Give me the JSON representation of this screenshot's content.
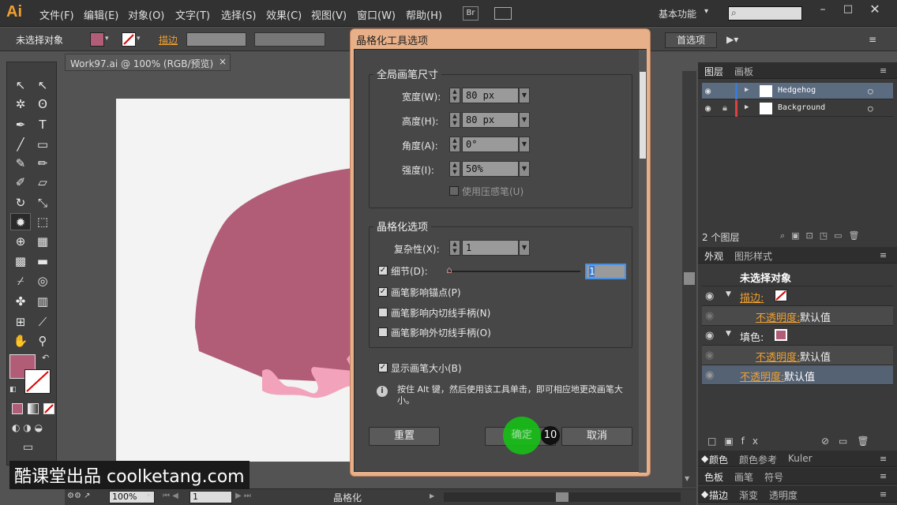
{
  "app": {
    "logo": "Ai"
  },
  "menus": [
    "文件(F)",
    "编辑(E)",
    "对象(O)",
    "文字(T)",
    "选择(S)",
    "效果(C)",
    "视图(V)",
    "窗口(W)",
    "帮助(H)"
  ],
  "menubar": {
    "br_label": "Br",
    "workspace": "基本功能",
    "workspace_arrow": "▾"
  },
  "control_bar": {
    "selection": "未选择对象",
    "stroke_label": "描边",
    "prefs_button": "首选项"
  },
  "document": {
    "tab_title": "Work97.ai @ 100% (RGB/预览)",
    "close": "×"
  },
  "status": {
    "zoom": "100%",
    "page": "1",
    "tool_name": "晶格化"
  },
  "colors": {
    "fill": "#b25d78",
    "hedgehog_light": "#f2a3bb",
    "accent": "#f0a030"
  },
  "dialog": {
    "title": "晶格化工具选项",
    "global_brush_group": "全局画笔尺寸",
    "width_label": "宽度(W):",
    "width_value": "80 px",
    "height_label": "高度(H):",
    "height_value": "80 px",
    "angle_label": "角度(A):",
    "angle_value": "0°",
    "intensity_label": "强度(I):",
    "intensity_value": "50%",
    "use_pressure": "使用压感笔(U)",
    "crystal_group": "晶格化选项",
    "complexity_label": "复杂性(X):",
    "complexity_value": "1",
    "detail_label": "细节(D):",
    "detail_value": "1",
    "brush_affects_anchor": "画笔影响锚点(P)",
    "brush_affects_in": "画笔影响内切线手柄(N)",
    "brush_affects_out": "画笔影响外切线手柄(O)",
    "show_brush_size": "显示画笔大小(B)",
    "hint": "按住 Alt 键，然后使用该工具单击，即可相应地更改画笔大小。",
    "reset_button": "重置",
    "ok_button": "确定",
    "cancel_button": "取消",
    "step_badge": "10"
  },
  "layers_panel": {
    "tabs": [
      "图层",
      "画板"
    ],
    "layers": [
      {
        "name": "Hedgehog",
        "color": "#3a7bd5"
      },
      {
        "name": "Background",
        "color": "#e04040"
      }
    ],
    "count": "2 个图层"
  },
  "appearance_panel": {
    "tabs": [
      "外观",
      "图形样式"
    ],
    "header": "未选择对象",
    "stroke_label": "描边:",
    "opacity_link": "不透明度:",
    "opacity_value": "默认值",
    "fill_label": "填色:"
  },
  "color_panel": {
    "tabs": [
      "颜色",
      "颜色参考",
      "Kuler"
    ]
  },
  "swatch_panel": {
    "tabs": [
      "色板",
      "画笔",
      "符号"
    ]
  },
  "stroke_panel": {
    "tabs": [
      "描边",
      "渐变",
      "透明度"
    ]
  },
  "watermark": "酷课堂出品 coolketang.com"
}
